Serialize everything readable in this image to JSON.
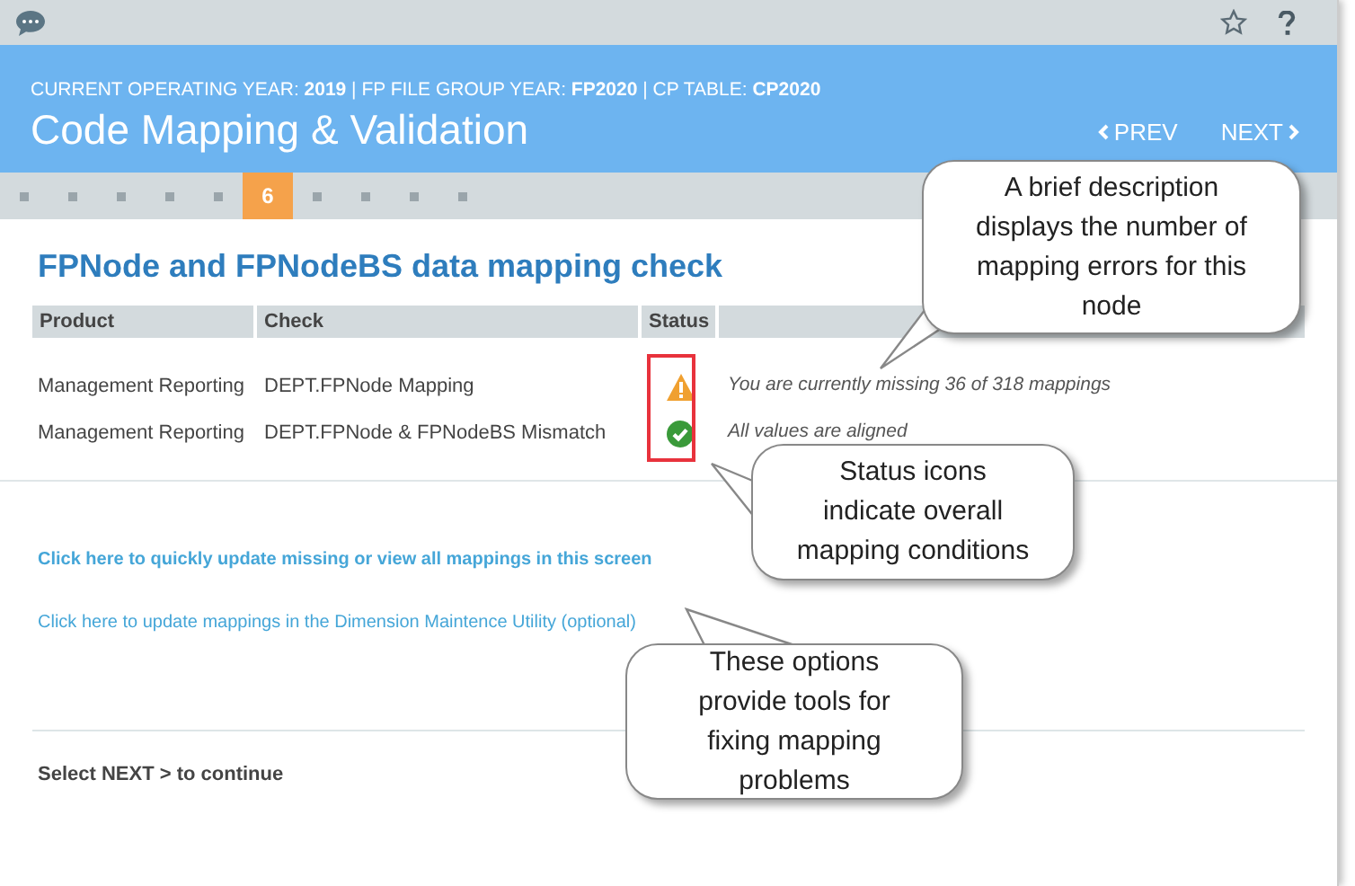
{
  "header": {
    "context": "CURRENT OPERATING YEAR: **2019** | FP FILE GROUP YEAR: **FP2020** | CP TABLE: **CP2020**",
    "title": "Code Mapping & Validation",
    "prev": "PREV",
    "next": "NEXT"
  },
  "steps": [
    {
      "selected": false
    },
    {
      "selected": false
    },
    {
      "selected": false
    },
    {
      "selected": false
    },
    {
      "selected": false
    },
    {
      "selected": true,
      "label": "6"
    },
    {
      "selected": false
    },
    {
      "selected": false
    },
    {
      "selected": false
    },
    {
      "selected": false
    }
  ],
  "heading": "FPNode and FPNodeBS data mapping check",
  "table": {
    "columns": [
      "Product",
      "Check",
      "Status"
    ],
    "rows": [
      {
        "product": "Management Reporting",
        "check": "DEPT.FPNode Mapping",
        "kind": "warning",
        "message": "You are currently missing 36 of 318 mappings"
      },
      {
        "product": "Management Reporting",
        "check": "DEPT.FPNode & FPNodeBS Mismatch",
        "kind": "ok",
        "message": "All values are aligned"
      }
    ]
  },
  "links": [
    {
      "text": "Click here to quickly update missing or view all mappings in this screen",
      "bold": true
    },
    {
      "text": "Click here to update mappings in the Dimension Maintence Utility (optional)",
      "bold": false
    }
  ],
  "footer": "Select NEXT > to continue",
  "callouts": [
    "A brief description displays the number of mapping errors for this node",
    "Status icons indicate overall mapping conditions",
    "These options provide tools for fixing mapping problems"
  ]
}
